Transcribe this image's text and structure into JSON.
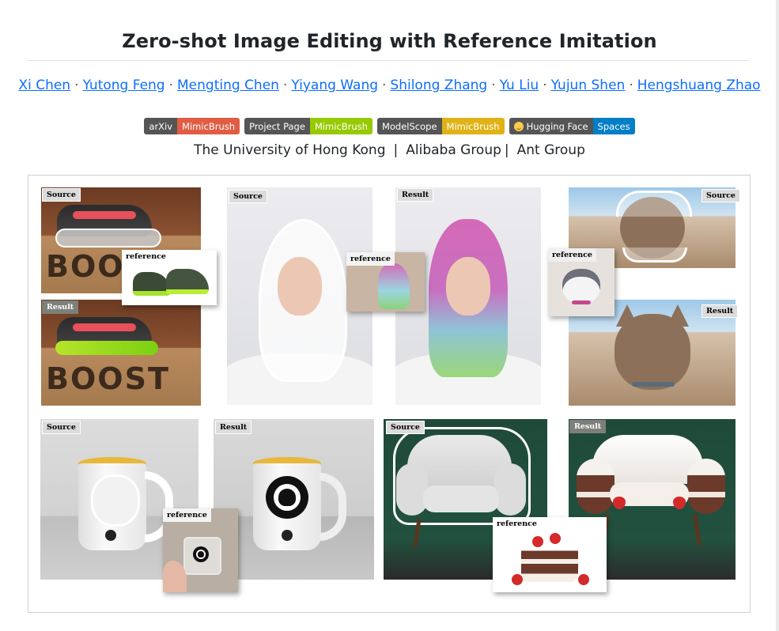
{
  "page": {
    "title": "Zero-shot Image Editing with Reference Imitation",
    "authors": [
      "Xi Chen",
      "Yutong Feng",
      "Mengting Chen",
      "Yiyang Wang",
      "Shilong Zhang",
      "Yu Liu",
      "Yujun Shen",
      "Hengshuang Zhao"
    ],
    "author_separator": "·",
    "badges": [
      {
        "left": "arXiv",
        "right": "MimicBrush",
        "color": "#e05d44"
      },
      {
        "left": "Project Page",
        "right": "MimicBrush",
        "color": "#97ca00"
      },
      {
        "left": "ModelScope",
        "right": "MimicBrush",
        "color": "#dfb317"
      },
      {
        "left": "Hugging Face",
        "right": "Spaces",
        "color": "#007ec6",
        "icon": "hugging-face-icon"
      }
    ],
    "affiliations": [
      "The University of Hong Kong",
      "Alibaba Group",
      "Ant Group"
    ],
    "affiliation_separator": "|"
  },
  "figure": {
    "labels": {
      "source": "Source",
      "result": "Result",
      "reference": "reference"
    },
    "panel_texts": {
      "shoe_box": "BOOST"
    }
  }
}
